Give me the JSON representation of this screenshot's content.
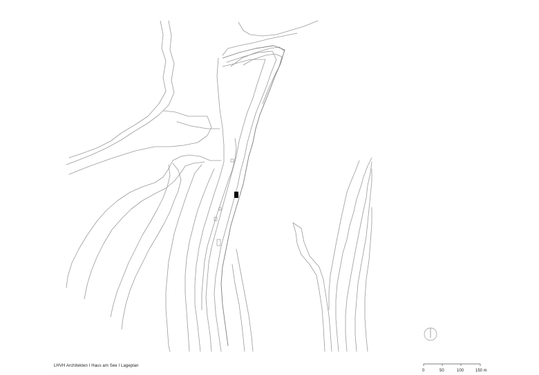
{
  "caption": "LHVH Architekten I Haus am See I Lageplan",
  "scale_bar": {
    "labels": [
      "0",
      "50",
      "100",
      "150 m"
    ]
  },
  "icons": {
    "north_arrow": "north-arrow-icon"
  },
  "colors": {
    "contour": "#9a9a9a",
    "building": "#000000",
    "text": "#222222"
  }
}
